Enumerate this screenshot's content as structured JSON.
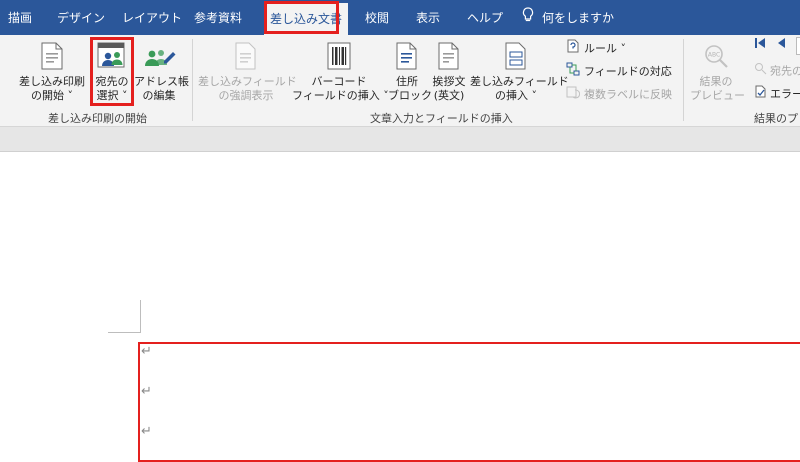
{
  "tabs": [
    "描画",
    "デザイン",
    "レイアウト",
    "参考資料",
    "差し込み文書",
    "校閲",
    "表示",
    "ヘルプ"
  ],
  "tell_me": "何をしますか",
  "groups": {
    "start": {
      "label": "差し込み印刷の開始",
      "start_merge": [
        "差し込み印刷",
        "の開始 ˅"
      ],
      "select_recipients": [
        "宛先の",
        "選択 ˅"
      ],
      "edit_list": [
        "アドレス帳",
        "の編集"
      ]
    },
    "write_insert": {
      "label": "文章入力とフィールドの挿入",
      "highlight_fields": [
        "差し込みフィールド",
        "の強調表示"
      ],
      "barcode": [
        "バーコード",
        "フィールドの挿入 ˅"
      ],
      "address_block": [
        "住所",
        "ブロック"
      ],
      "greeting": [
        "挨拶文",
        "(英文)"
      ],
      "insert_field": [
        "差し込みフィールド",
        "の挿入 ˅"
      ],
      "rules": "ルール ˅",
      "match_fields": "フィールドの対応",
      "update_labels": "複数ラベルに反映"
    },
    "preview": {
      "label": "結果のプ",
      "preview_results": [
        "結果の",
        "プレビュー"
      ],
      "find_recipient": "宛先の",
      "check_errors": "エラー"
    }
  },
  "document": {
    "paragraph_marks": [
      "↵",
      "↵",
      "↵"
    ]
  },
  "colors": {
    "accent": "#2b579a",
    "highlight": "#e4201e"
  }
}
